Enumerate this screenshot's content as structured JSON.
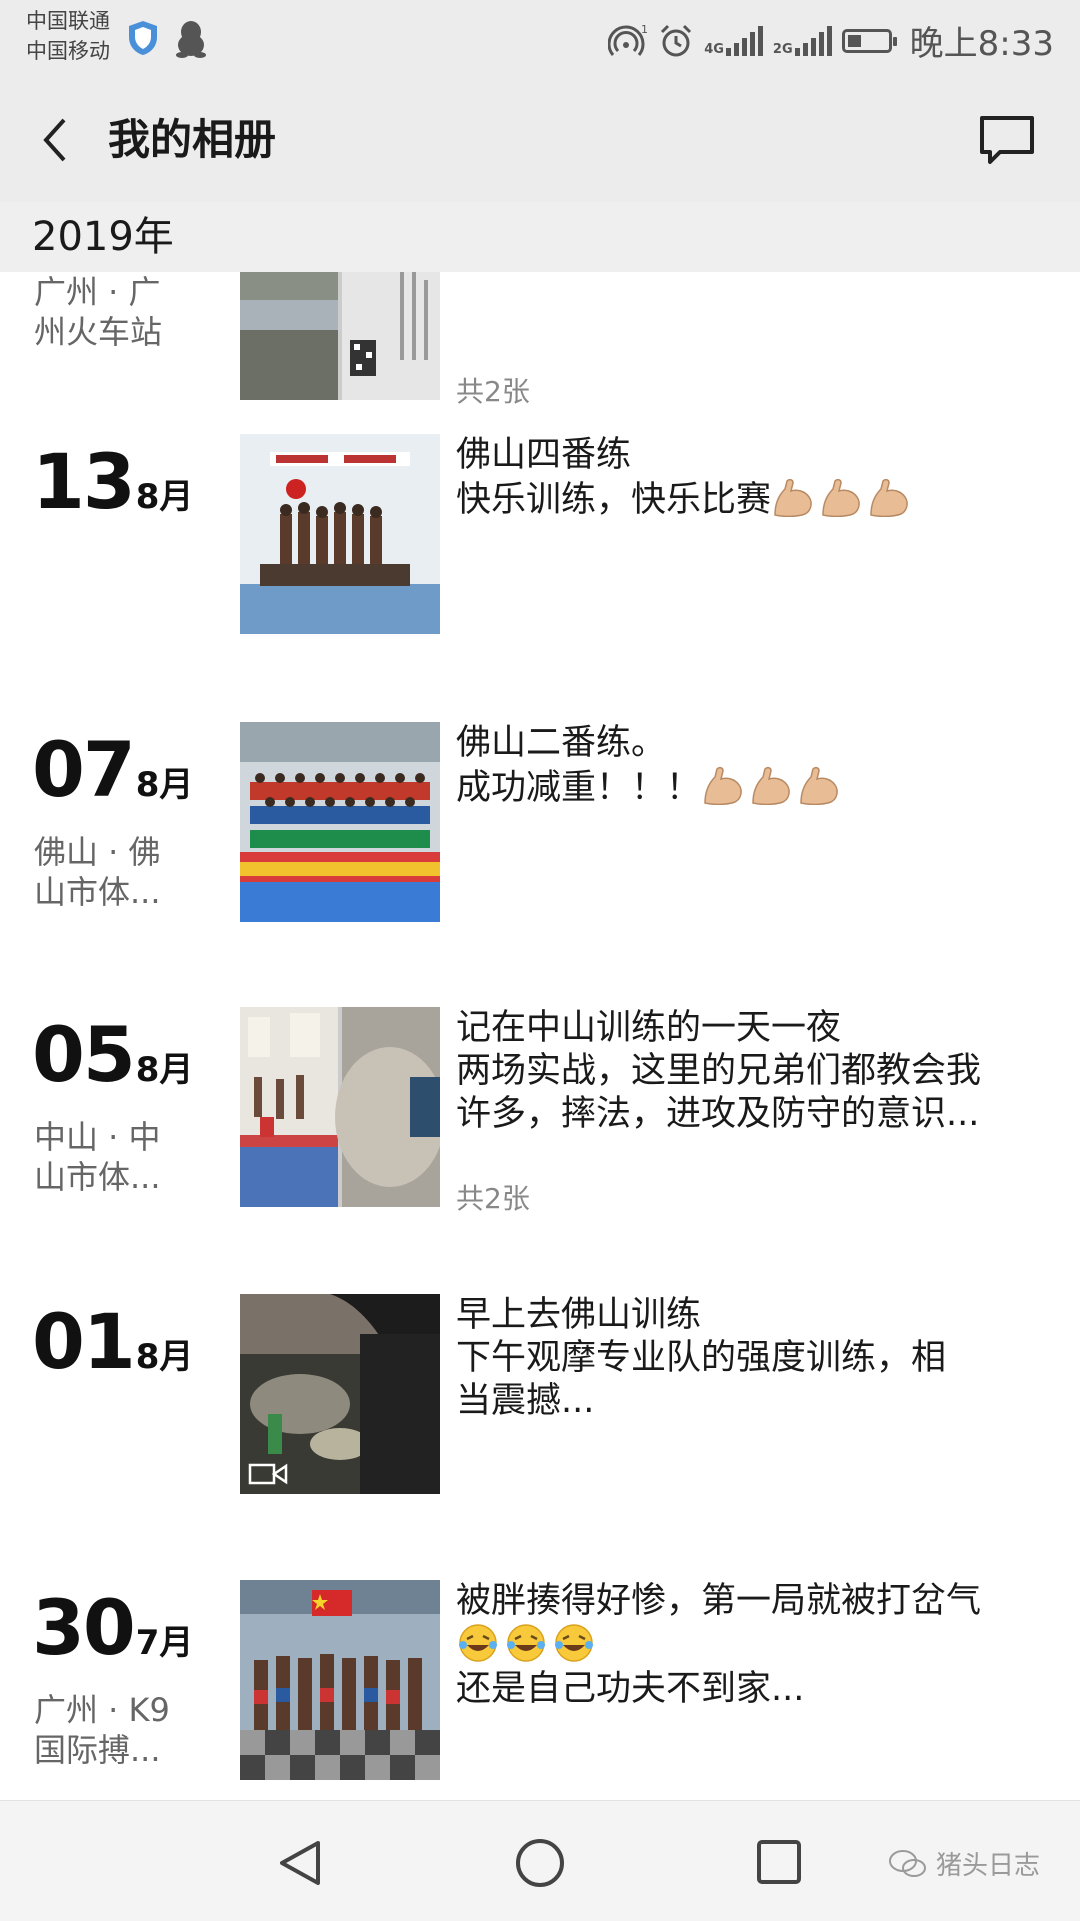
{
  "status_bar": {
    "carrier1": "中国联通",
    "carrier2": "中国移动",
    "sig1_label": "4G",
    "sig2_label": "2G",
    "time": "晚上8:33",
    "battery_level": 0.35
  },
  "header": {
    "title": "我的相册"
  },
  "year_label": "2019年",
  "entries": [
    {
      "day": "",
      "month": "",
      "location": "广州 · 广\n州火车站",
      "lines": [],
      "count": "共2张"
    },
    {
      "day": "13",
      "month": "8月",
      "location": "",
      "lines": [
        "佛山四番练",
        "快乐训练，快乐比赛"
      ],
      "count": ""
    },
    {
      "day": "07",
      "month": "8月",
      "location": "佛山 · 佛\n山市体...",
      "lines": [
        "佛山二番练。",
        "成功减重！！！"
      ],
      "count": ""
    },
    {
      "day": "05",
      "month": "8月",
      "location": "中山 · 中\n山市体...",
      "lines": [
        "记在中山训练的一天一夜",
        "两场实战，这里的兄弟们都教会我",
        "许多，摔法，进攻及防守的意识..."
      ],
      "count": "共2张"
    },
    {
      "day": "01",
      "month": "8月",
      "location": "",
      "lines": [
        "早上去佛山训练",
        "下午观摩专业队的强度训练，相",
        "当震撼..."
      ],
      "count": ""
    },
    {
      "day": "30",
      "month": "7月",
      "location": "广州 · K9\n国际搏...",
      "lines": [
        "被胖揍得好惨，第一局就被打岔气",
        "",
        "还是自己功夫不到家..."
      ],
      "count": ""
    }
  ],
  "icons": {
    "back": "chevron-left-icon",
    "message": "speech-bubble-icon",
    "flex": "flexed-biceps-emoji",
    "laugh": "rolling-laughing-emoji",
    "video": "video-camera-icon"
  },
  "watermark": "猪头日志"
}
